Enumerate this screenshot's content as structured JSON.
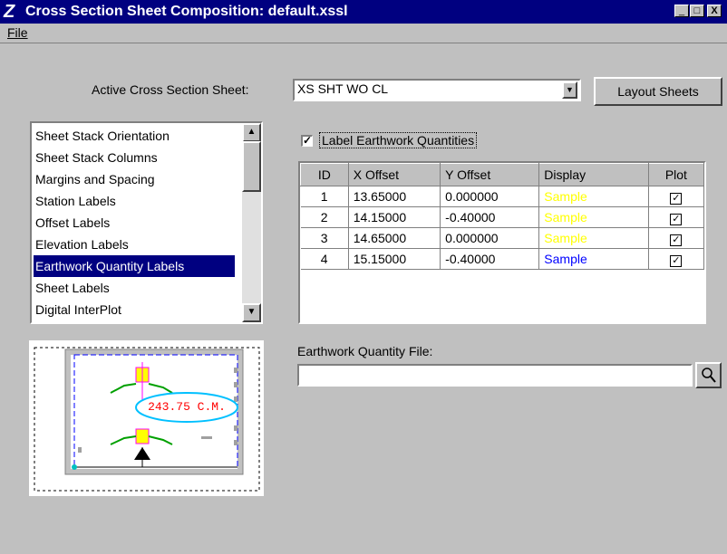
{
  "window": {
    "title": "Cross Section Sheet Composition: default.xssl",
    "min": "_",
    "max": "□",
    "close": "X"
  },
  "menu": {
    "file": "File"
  },
  "active_sheet": {
    "label": "Active Cross Section Sheet:",
    "value": "XS SHT WO CL"
  },
  "layout_button": "Layout Sheets",
  "list": {
    "items": [
      "Sheet Stack Orientation",
      "Sheet Stack Columns",
      "Margins and Spacing",
      "Station Labels",
      "Offset Labels",
      "Elevation Labels",
      "Earthwork Quantity Labels",
      "Sheet Labels",
      "Digital InterPlot"
    ],
    "selected": "Earthwork Quantity Labels"
  },
  "label_checkbox": {
    "label": "Label Earthwork Quantities",
    "checked": true
  },
  "table": {
    "headers": [
      "ID",
      "X Offset",
      "Y Offset",
      "Display",
      "Plot"
    ],
    "rows": [
      {
        "id": "1",
        "x": "13.65000",
        "y": "0.000000",
        "display": "Sample",
        "color": "#ffff00",
        "plot": true
      },
      {
        "id": "2",
        "x": "14.15000",
        "y": "-0.40000",
        "display": "Sample",
        "color": "#ffff00",
        "plot": true
      },
      {
        "id": "3",
        "x": "14.65000",
        "y": "0.000000",
        "display": "Sample",
        "color": "#ffff00",
        "plot": true
      },
      {
        "id": "4",
        "x": "15.15000",
        "y": "-0.40000",
        "display": "Sample",
        "color": "#0000ff",
        "plot": true
      }
    ]
  },
  "earthwork_file": {
    "label": "Earthwork Quantity File:",
    "value": ""
  },
  "preview": {
    "label": "243.75 C.M."
  },
  "colors": {
    "titlebar": "#000080",
    "selection": "#000080"
  }
}
